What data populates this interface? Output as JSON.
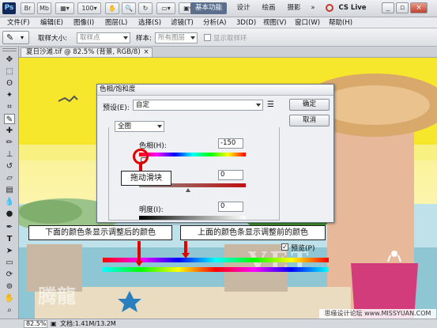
{
  "titlebar": {
    "app_logo": "Ps",
    "workspace_active": "基本功能",
    "workspaces": [
      "设计",
      "绘画",
      "摄影"
    ],
    "more": "»",
    "cs_live": "CS Live",
    "window_minimize": "_",
    "window_restore": "▫",
    "window_close": "×"
  },
  "menu": [
    "文件(F)",
    "编辑(E)",
    "图像(I)",
    "图层(L)",
    "选择(S)",
    "滤镜(T)",
    "分析(A)",
    "3D(D)",
    "视图(V)",
    "窗口(W)",
    "帮助(H)"
  ],
  "options": {
    "sample_size_label": "取样大小:",
    "sample_size_value": "取样点",
    "sample_label": "样本:",
    "sample_value": "所有图层",
    "show_ring_label": "显示取样环"
  },
  "document": {
    "tab_label": "夏日沙滩.tif @ 82.5% (背景, RGB/8)",
    "tab_close": "×"
  },
  "status": {
    "zoom": "82.5%",
    "doc_info": "文档:1.41M/13.2M"
  },
  "dialog": {
    "title": "色相/饱和度",
    "preset_label": "预设(E):",
    "preset_value": "自定",
    "ok": "确定",
    "cancel": "取消",
    "channel_value": "全图",
    "hue_label": "色相(H):",
    "hue_value": "-150",
    "saturation_value": "0",
    "lightness_label": "明度(I):",
    "lightness_value": "0",
    "preview_label": "预览(P)"
  },
  "callouts": {
    "drag_slider": "拖动滑块",
    "bottom_bar": "下面的颜色条显示调整后的颜色",
    "top_bar": "上面的颜色条显示调整前的颜色"
  },
  "watermarks": {
    "site": "思缘设计论坛  www.MISSYUAN.COM",
    "overlay_left": "腾龍",
    "overlay_right": "VET"
  },
  "colors": {
    "accent_red": "#e00000",
    "workspace_active_bg": "#5b6f8c",
    "canvas_yellow": "#f7ea33"
  }
}
